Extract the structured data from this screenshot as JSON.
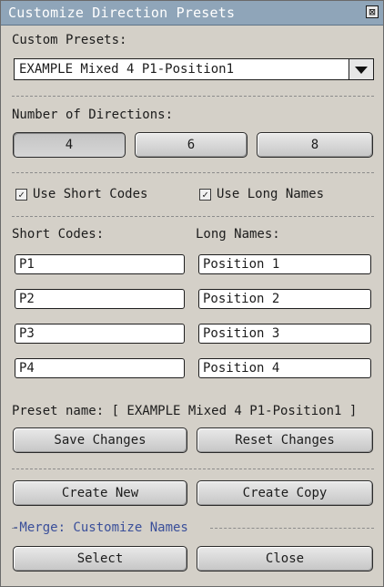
{
  "window": {
    "title": "Customize Direction Presets",
    "close_glyph": "⊠"
  },
  "presets": {
    "label": "Custom Presets:",
    "selected": "EXAMPLE Mixed 4 P1-Position1"
  },
  "directions": {
    "label": "Number of Directions:",
    "options": [
      "4",
      "6",
      "8"
    ],
    "selected": "4"
  },
  "checkboxes": [
    {
      "label": "Use Short Codes",
      "checked": true
    },
    {
      "label": "Use Long Names",
      "checked": true
    }
  ],
  "short_codes": {
    "label": "Short Codes:",
    "values": [
      "P1",
      "P2",
      "P3",
      "P4"
    ]
  },
  "long_names": {
    "label": "Long Names:",
    "values": [
      "Position 1",
      "Position 2",
      "Position 3",
      "Position 4"
    ]
  },
  "preset_name": {
    "text": "Preset name: [ EXAMPLE Mixed 4 P1-Position1 ]"
  },
  "buttons": {
    "save": "Save Changes",
    "reset": "Reset Changes",
    "create_new": "Create New",
    "create_copy": "Create Copy",
    "select": "Select",
    "close": "Close"
  },
  "merge_link": "-Merge: Customize Names",
  "icons": {
    "close": "close-icon",
    "dropdown": "chevron-down-icon",
    "checkbox": "check-icon"
  }
}
